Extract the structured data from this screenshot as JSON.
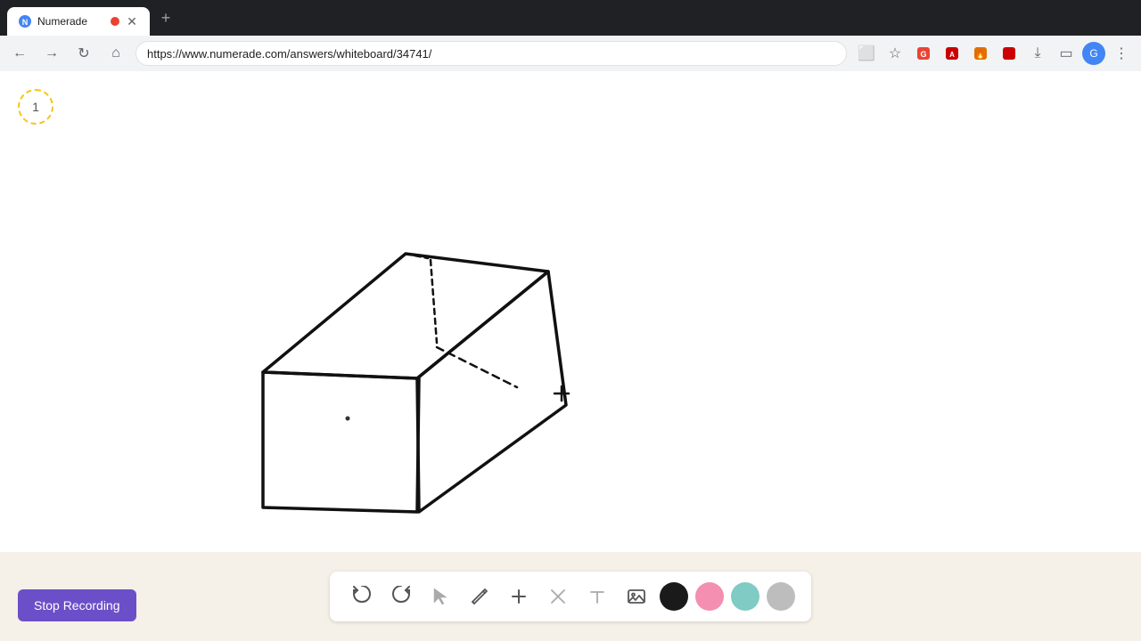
{
  "browser": {
    "tab_title": "Numerade",
    "tab_favicon": "N",
    "url": "https://www.numerade.com/answers/whiteboard/34741/",
    "new_tab_icon": "+"
  },
  "nav": {
    "back_icon": "←",
    "forward_icon": "→",
    "refresh_icon": "↻",
    "home_icon": "⌂"
  },
  "step_counter": "1",
  "toolbar": {
    "undo_label": "↩",
    "redo_label": "↪",
    "select_label": "▷",
    "pencil_label": "✎",
    "plus_label": "+",
    "eraser_label": "/",
    "text_label": "A",
    "image_label": "🖼",
    "colors": [
      "#1a1a1a",
      "#f48fb1",
      "#80cbc4",
      "#bdbdbd"
    ]
  },
  "stop_recording": {
    "label": "Stop Recording"
  }
}
